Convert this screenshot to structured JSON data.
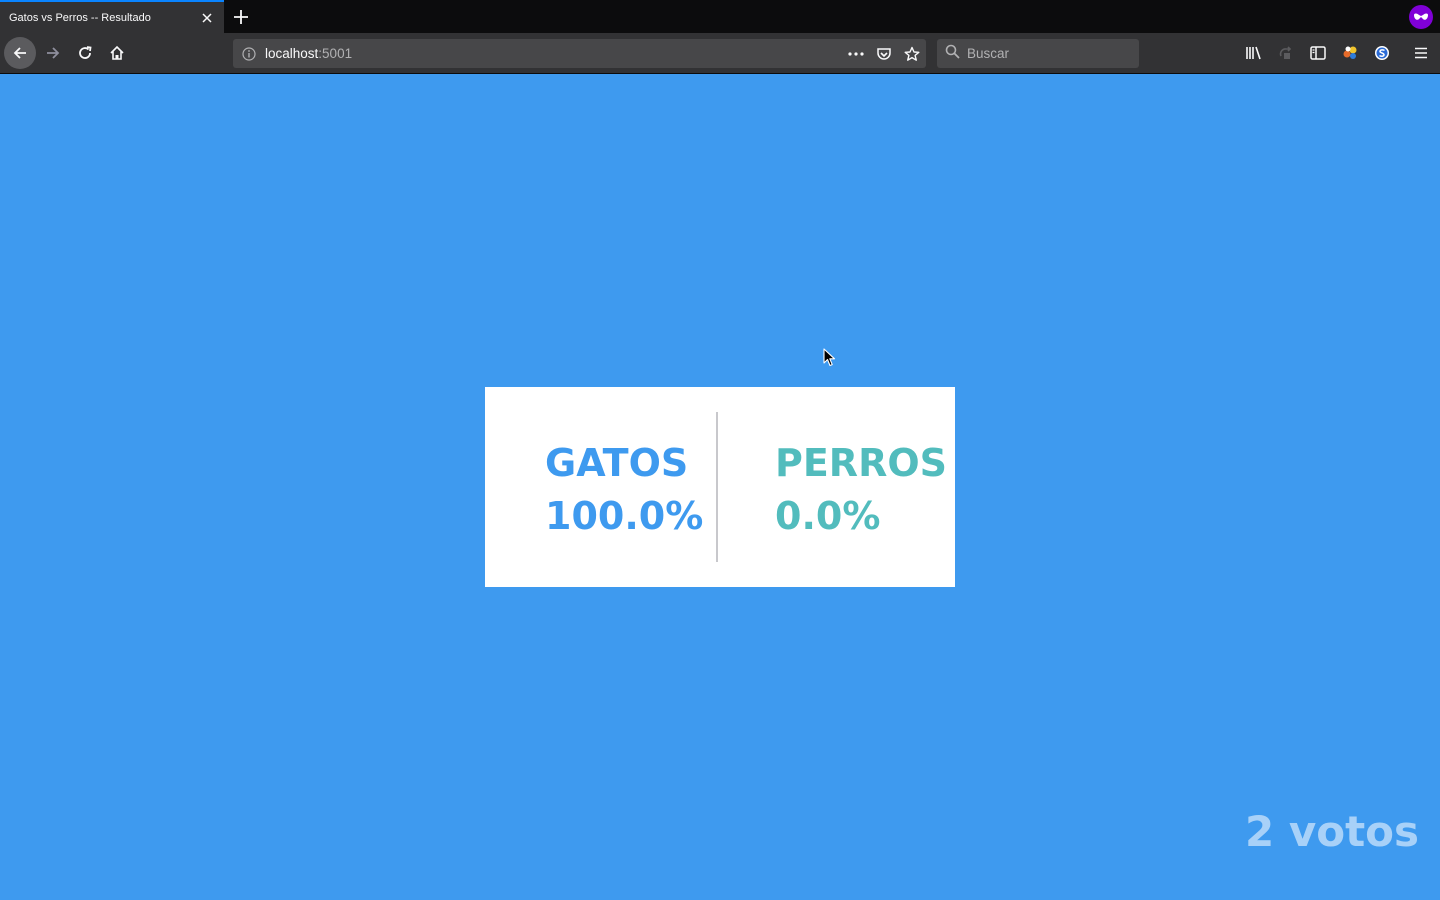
{
  "browser": {
    "tab": {
      "title": "Gatos vs Perros -- Resultado"
    },
    "url": {
      "host": "localhost",
      "port": ":5001"
    },
    "search": {
      "placeholder": "Buscar"
    },
    "colors": {
      "tab_accent": "#0a84ff",
      "private_badge": "#8000d7"
    }
  },
  "page": {
    "background": "#3e9aef",
    "results": {
      "cats": {
        "label": "GATOS",
        "percent": "100.0%",
        "color": "#3e9aef"
      },
      "dogs": {
        "label": "PERROS",
        "percent": "0.0%",
        "color": "#52bcbd"
      }
    },
    "vote_count": "2 votos"
  }
}
